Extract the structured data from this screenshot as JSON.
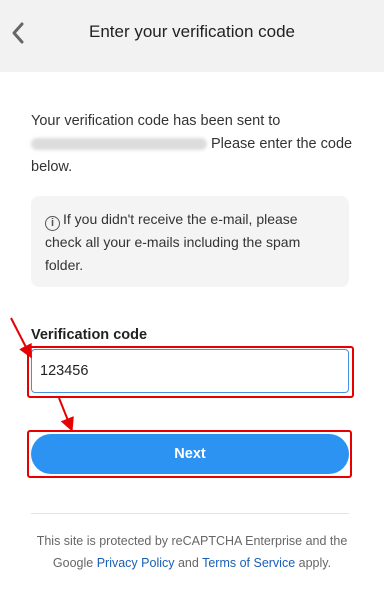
{
  "header": {
    "title": "Enter your verification code"
  },
  "intro": {
    "line1": "Your verification code has been sent to",
    "line2_suffix": "Please enter the code below."
  },
  "info": {
    "text": "If you didn't receive the e-mail, please check all your e-mails including the spam folder."
  },
  "form": {
    "label": "Verification code",
    "value": "123456",
    "next_label": "Next"
  },
  "footer": {
    "prefix": "This site is protected by reCAPTCHA Enterprise and the Google ",
    "privacy": "Privacy Policy",
    "and": " and ",
    "terms": "Terms of Service",
    "suffix": " apply."
  },
  "colors": {
    "primary": "#2c93f2",
    "annotation": "#e60000"
  },
  "icons": {
    "back": "chevron-left-icon",
    "info": "info-circle-icon"
  }
}
